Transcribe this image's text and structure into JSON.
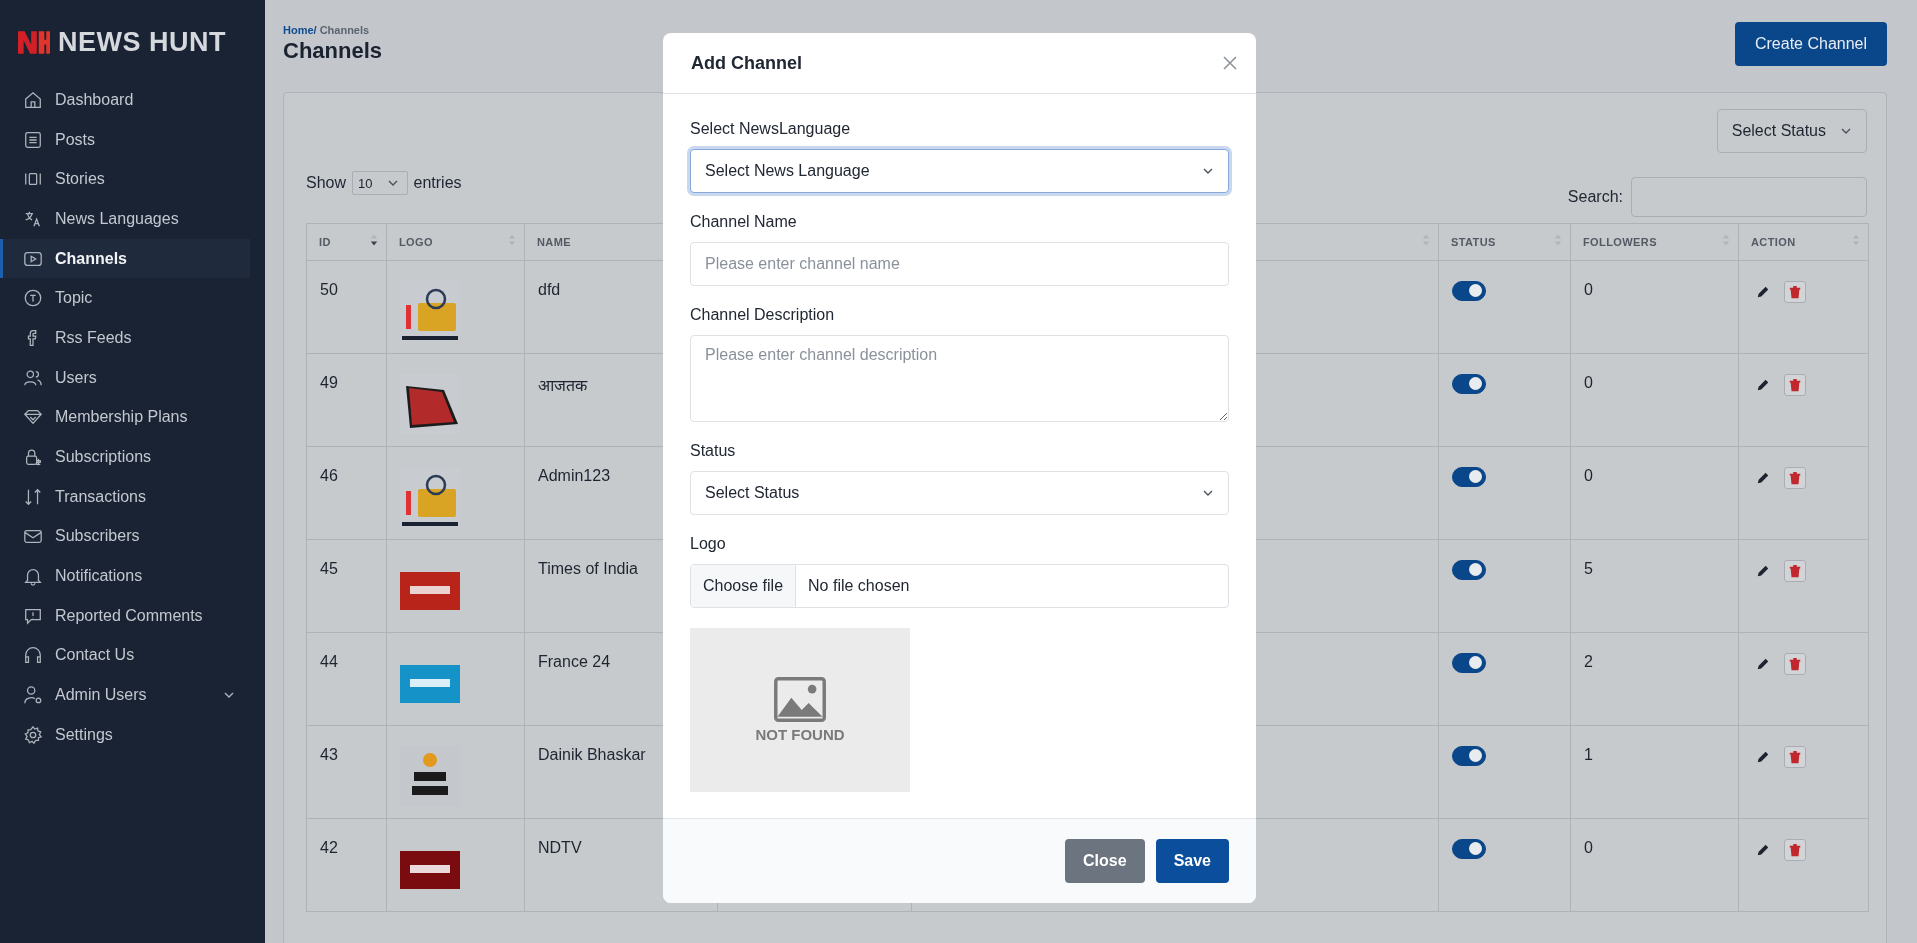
{
  "sidebar": {
    "brand": "NEWS HUNT",
    "items": [
      {
        "label": "Dashboard",
        "selected": false,
        "kind": "link"
      },
      {
        "label": "Posts",
        "selected": false,
        "kind": "link"
      },
      {
        "label": "Stories",
        "selected": false,
        "kind": "link"
      },
      {
        "label": "News Languages",
        "selected": false,
        "kind": "link"
      },
      {
        "label": "Channels",
        "selected": true,
        "kind": "link"
      },
      {
        "label": "Topic",
        "selected": false,
        "kind": "link"
      },
      {
        "label": "Rss Feeds",
        "selected": false,
        "kind": "link"
      },
      {
        "label": "Users",
        "selected": false,
        "kind": "link"
      },
      {
        "label": "Membership Plans",
        "selected": false,
        "kind": "link"
      },
      {
        "label": "Subscriptions",
        "selected": false,
        "kind": "link"
      },
      {
        "label": "Transactions",
        "selected": false,
        "kind": "link"
      },
      {
        "label": "Subscribers",
        "selected": false,
        "kind": "link"
      },
      {
        "label": "Notifications",
        "selected": false,
        "kind": "link"
      },
      {
        "label": "Reported Comments",
        "selected": false,
        "kind": "link"
      },
      {
        "label": "Contact Us",
        "selected": false,
        "kind": "link"
      },
      {
        "label": "Admin Users",
        "selected": false,
        "kind": "group"
      },
      {
        "label": "Settings",
        "selected": false,
        "kind": "link"
      }
    ]
  },
  "header": {
    "breadcrumb": [
      "Home/",
      "Channels"
    ],
    "title": "Channels",
    "create_button": "Create Channel"
  },
  "filters": {
    "status_select": "Select Status",
    "show_label": "Show",
    "page_size": "10",
    "entries_label": "entries",
    "search_label": "Search:"
  },
  "table": {
    "columns": [
      {
        "label": "ID",
        "sorted": true
      },
      {
        "label": "LOGO",
        "sorted": false
      },
      {
        "label": "NAME"
      },
      {},
      {
        "sorted": false
      },
      {
        "label": "STATUS",
        "sorted": false
      },
      {
        "label": "FOLLOWERS",
        "sorted": false
      },
      {
        "label": "ACTION",
        "sorted": false
      }
    ],
    "rows": [
      {
        "id": "50",
        "name": "dfd",
        "on": true,
        "followers": "0"
      },
      {
        "id": "49",
        "name": "आजतक",
        "on": true,
        "followers": "0"
      },
      {
        "id": "46",
        "name": "Admin123",
        "on": true,
        "followers": "0"
      },
      {
        "id": "45",
        "name": "Times of India",
        "on": true,
        "followers": "5"
      },
      {
        "id": "44",
        "name": "France 24",
        "on": true,
        "followers": "2"
      },
      {
        "id": "43",
        "name": "Dainik Bhaskar",
        "on": true,
        "followers": "1"
      },
      {
        "id": "42",
        "name": "NDTV",
        "on": true,
        "followers": "0"
      }
    ]
  },
  "modal": {
    "title": "Add Channel",
    "fields": [
      {
        "kind": "select",
        "label": "Select NewsLanguage",
        "value": "Select News Language",
        "focused": true
      },
      {
        "kind": "text",
        "label": "Channel Name",
        "placeholder": "Please enter channel name",
        "focused": false
      },
      {
        "kind": "textarea",
        "label": "Channel Description",
        "placeholder": "Please enter channel description",
        "focused": false
      },
      {
        "kind": "select",
        "label": "Status",
        "value": "Select Status",
        "focused": false
      },
      {
        "kind": "file",
        "label": "Logo",
        "button": "Choose file",
        "value": "No file chosen",
        "focused": false
      }
    ],
    "preview": {
      "text": "NOT FOUND"
    },
    "buttons": [
      {
        "label": "Close",
        "kind": "secondary"
      },
      {
        "label": "Save",
        "kind": "primary"
      }
    ]
  }
}
